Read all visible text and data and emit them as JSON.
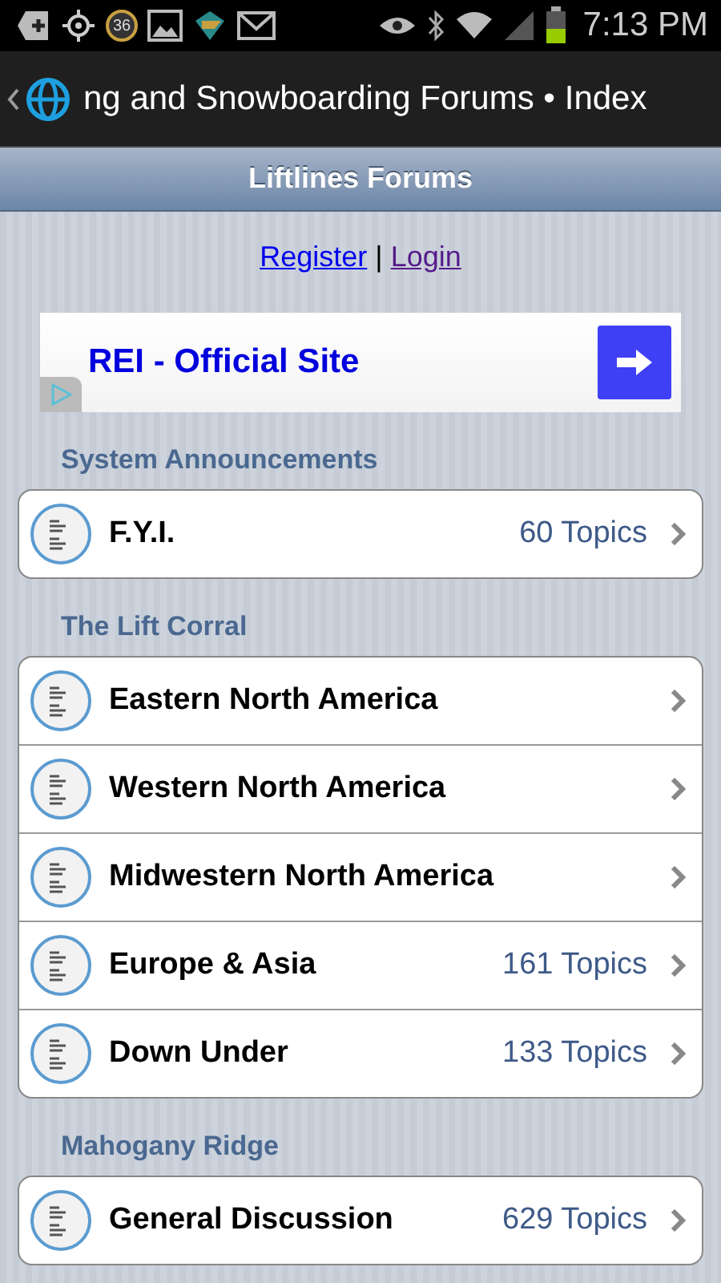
{
  "status_bar": {
    "badge": "36",
    "time": "7:13 PM"
  },
  "action_bar": {
    "title": "ng and Snowboarding Forums • Index"
  },
  "header": {
    "title": "Liftlines Forums"
  },
  "auth_links": [
    {
      "label": "Register",
      "visited": false
    },
    {
      "label": "Login",
      "visited": true
    }
  ],
  "auth_separator": "|",
  "ad": {
    "text": "REI - Official Site"
  },
  "sections": [
    {
      "title": "System Announcements",
      "forums": [
        {
          "name": "F.Y.I.",
          "topics": "60 Topics"
        }
      ]
    },
    {
      "title": "The Lift Corral",
      "forums": [
        {
          "name": "Eastern North America"
        },
        {
          "name": "Western North America"
        },
        {
          "name": "Midwestern North America"
        },
        {
          "name": "Europe & Asia",
          "topics": "161 Topics"
        },
        {
          "name": "Down Under",
          "topics": "133 Topics"
        }
      ]
    },
    {
      "title": "Mahogany Ridge",
      "forums": [
        {
          "name": "General Discussion",
          "topics": "629 Topics"
        }
      ]
    }
  ]
}
